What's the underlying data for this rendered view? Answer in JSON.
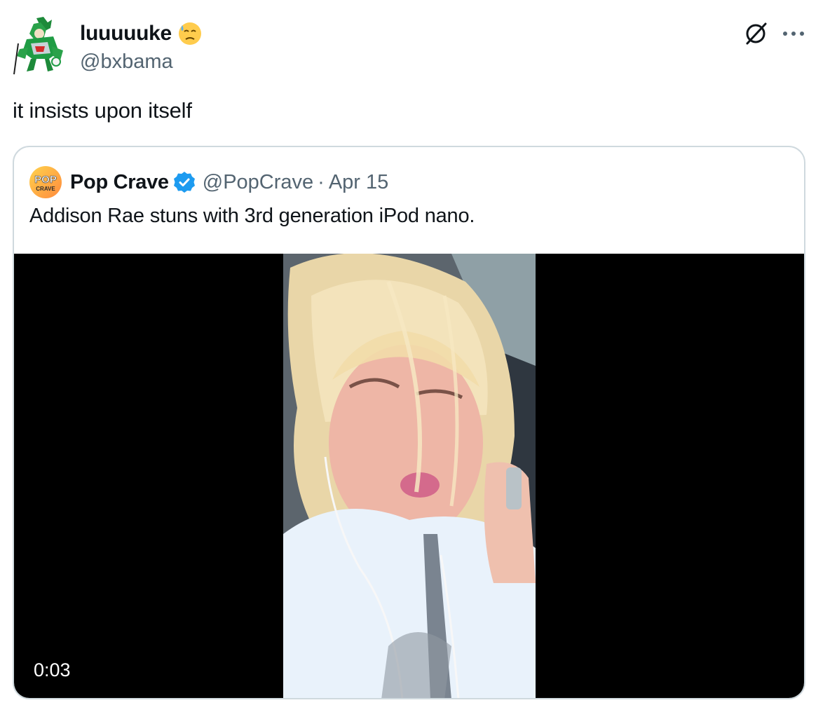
{
  "tweet": {
    "author": {
      "name": "luuuuuke",
      "handle": "@bxbama",
      "emoji": "downcast-face-with-sweat-emoji"
    },
    "text": "it insists upon itself",
    "icons": {
      "grok": "grok-icon",
      "more": "more-options-icon"
    }
  },
  "quote": {
    "author": {
      "name": "Pop Crave",
      "handle": "@PopCrave",
      "separator": "·",
      "date": "Apr 15",
      "verified": true,
      "avatar_text_top": "POP",
      "avatar_text_bottom": "CRAVE"
    },
    "text": "Addison Rae stuns with 3rd generation iPod nano.",
    "media": {
      "type": "video",
      "duration": "0:03"
    }
  },
  "colors": {
    "primary_text": "#0f1419",
    "secondary_text": "#536471",
    "border": "#cfd9de",
    "verified_blue": "#1d9bf0",
    "media_bg": "#000000"
  }
}
